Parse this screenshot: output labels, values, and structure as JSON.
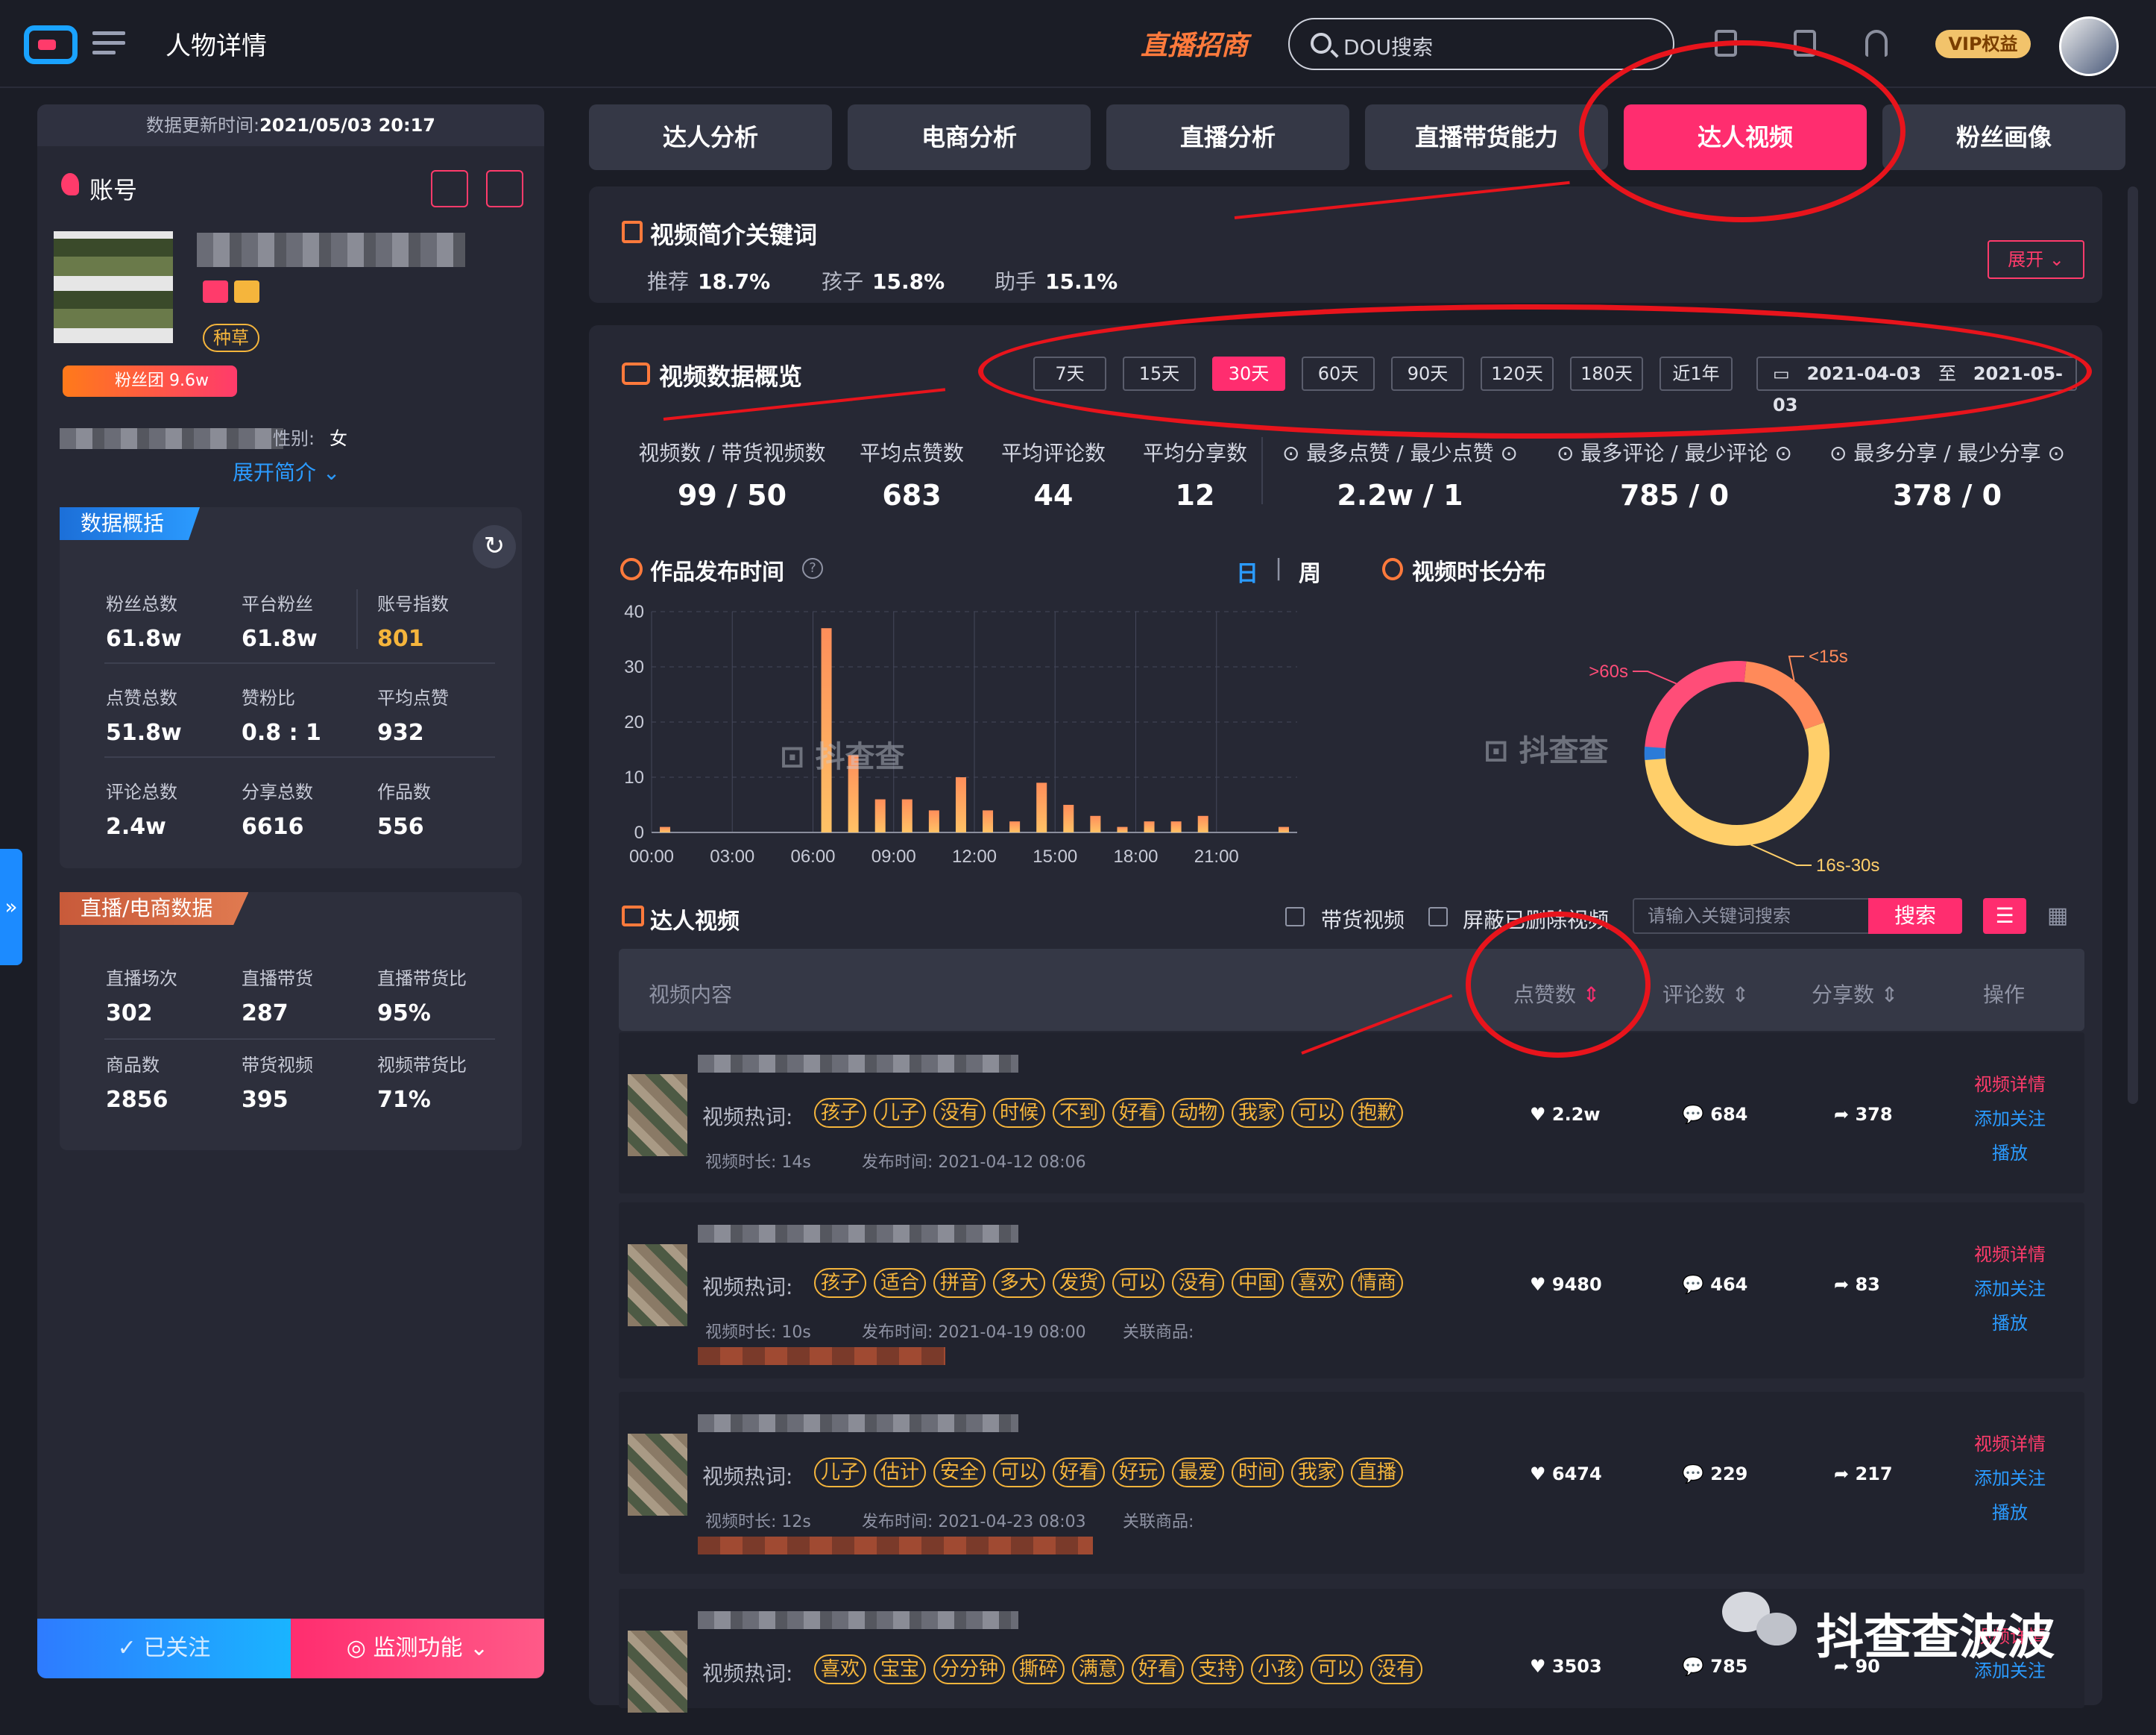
{
  "header": {
    "page_title": "人物详情",
    "live_merchant": "直播招商",
    "search_placeholder": "DOU搜索",
    "vip_label": "VIP权益"
  },
  "left": {
    "update_time_label": "数据更新时间:",
    "update_time": "2021/05/03 20:17",
    "account_title": "账号",
    "seed_tag": "种草",
    "fans_group": "粉丝团 9.6w",
    "gender_label": "性别:",
    "gender": "女",
    "expand_intro": "展开简介",
    "overview_title": "数据概括",
    "overview": [
      {
        "label": "粉丝总数",
        "value": "61.8w"
      },
      {
        "label": "平台粉丝",
        "value": "61.8w"
      },
      {
        "label": "账号指数",
        "value": "801"
      },
      {
        "label": "点赞总数",
        "value": "51.8w"
      },
      {
        "label": "赞粉比",
        "value": "0.8 : 1"
      },
      {
        "label": "平均点赞",
        "value": "932"
      },
      {
        "label": "评论总数",
        "value": "2.4w"
      },
      {
        "label": "分享总数",
        "value": "6616"
      },
      {
        "label": "作品数",
        "value": "556"
      }
    ],
    "live_title": "直播/电商数据",
    "live": [
      {
        "label": "直播场次",
        "value": "302"
      },
      {
        "label": "直播带货",
        "value": "287"
      },
      {
        "label": "直播带货比",
        "value": "95%"
      },
      {
        "label": "商品数",
        "value": "2856"
      },
      {
        "label": "带货视频",
        "value": "395"
      },
      {
        "label": "视频带货比",
        "value": "71%"
      }
    ],
    "followed": "已关注",
    "monitor": "监测功能"
  },
  "tabs": [
    "达人分析",
    "电商分析",
    "直播分析",
    "直播带货能力",
    "达人视频",
    "粉丝画像"
  ],
  "keywords": {
    "title": "视频简介关键词",
    "items": [
      {
        "label": "推荐",
        "value": "18.7%"
      },
      {
        "label": "孩子",
        "value": "15.8%"
      },
      {
        "label": "助手",
        "value": "15.1%"
      }
    ],
    "expand": "展开"
  },
  "overview": {
    "title": "视频数据概览",
    "ranges": [
      "7天",
      "15天",
      "30天",
      "60天",
      "90天",
      "120天",
      "180天",
      "近1年"
    ],
    "active_range": "30天",
    "date_from": "2021-04-03",
    "date_sep": "至",
    "date_to": "2021-05-03",
    "stats": [
      {
        "label": "视频数 / 带货视频数",
        "value": "99 / 50"
      },
      {
        "label": "平均点赞数",
        "value": "683"
      },
      {
        "label": "平均评论数",
        "value": "44"
      },
      {
        "label": "平均分享数",
        "value": "12"
      },
      {
        "label": "最多点赞 / 最少点赞",
        "value": "2.2w / 1"
      },
      {
        "label": "最多评论 / 最少评论",
        "value": "785 / 0"
      },
      {
        "label": "最多分享 / 最少分享",
        "value": "378 / 0"
      }
    ]
  },
  "publish_chart_title": "作品发布时间",
  "day": "日",
  "week": "周",
  "duration_title": "视频时长分布",
  "watermark": "抖查查",
  "chart_data": [
    {
      "type": "bar",
      "title": "作品发布时间",
      "x_ticks": [
        "00:00",
        "03:00",
        "06:00",
        "09:00",
        "12:00",
        "15:00",
        "18:00",
        "21:00"
      ],
      "y_ticks": [
        "0",
        "10",
        "20",
        "30",
        "40"
      ],
      "ylim": [
        0,
        40
      ],
      "hours": [
        0.5,
        6.5,
        7.5,
        8.5,
        9.5,
        10.5,
        11.5,
        12.5,
        13.5,
        14.5,
        15.5,
        16.5,
        17.5,
        18.5,
        19.5,
        20.5,
        23.5
      ],
      "values": [
        1,
        37,
        14,
        6,
        6,
        4,
        10,
        4,
        2,
        9,
        5,
        3,
        1,
        2,
        2,
        3,
        1
      ]
    },
    {
      "type": "pie",
      "title": "视频时长分布",
      "labels": [
        "<15s",
        "16s-30s",
        ">60s"
      ],
      "values": [
        18,
        56,
        26
      ],
      "colors": [
        "#ff8a5a",
        "#ffcf6a",
        "#ff4d78"
      ]
    }
  ],
  "videos_section": {
    "title": "达人视频",
    "filter_goods": "带货视频",
    "filter_deleted": "屏蔽已删除视频",
    "search_placeholder": "请输入关键词搜索",
    "search_btn": "搜索",
    "col_content": "视频内容",
    "col_likes": "点赞数",
    "col_comments": "评论数",
    "col_shares": "分享数",
    "col_action": "操作"
  },
  "videos": [
    {
      "hot_label": "视频热词:",
      "tags": [
        "孩子",
        "儿子",
        "没有",
        "时候",
        "不到",
        "好看",
        "动物",
        "我家",
        "可以",
        "抱歉"
      ],
      "duration": "视频时长:  14s",
      "publish": "发布时间:  2021-04-12 08:06",
      "goods": "",
      "likes": "2.2w",
      "comments": "684",
      "shares": "378",
      "a1": "视频详情",
      "a2": "添加关注",
      "a3": "播放"
    },
    {
      "hot_label": "视频热词:",
      "tags": [
        "孩子",
        "适合",
        "拼音",
        "多大",
        "发货",
        "可以",
        "没有",
        "中国",
        "喜欢",
        "情商"
      ],
      "duration": "视频时长:  10s",
      "publish": "发布时间:  2021-04-19 08:00",
      "goods": "关联商品:",
      "likes": "9480",
      "comments": "464",
      "shares": "83",
      "a1": "视频详情",
      "a2": "添加关注",
      "a3": "播放"
    },
    {
      "hot_label": "视频热词:",
      "tags": [
        "儿子",
        "估计",
        "安全",
        "可以",
        "好看",
        "好玩",
        "最爱",
        "时间",
        "我家",
        "直播"
      ],
      "duration": "视频时长:  12s",
      "publish": "发布时间:  2021-04-23 08:03",
      "goods": "关联商品:",
      "likes": "6474",
      "comments": "229",
      "shares": "217",
      "a1": "视频详情",
      "a2": "添加关注",
      "a3": "播放"
    },
    {
      "hot_label": "视频热词:",
      "tags": [
        "喜欢",
        "宝宝",
        "分分钟",
        "撕碎",
        "满意",
        "好看",
        "支持",
        "小孩",
        "可以",
        "没有"
      ],
      "duration": "",
      "publish": "",
      "goods": "",
      "likes": "3503",
      "comments": "785",
      "shares": "90",
      "a1": "视频详情",
      "a2": "添加关注",
      "a3": ""
    }
  ],
  "wechat_watermark": "抖查查波波"
}
